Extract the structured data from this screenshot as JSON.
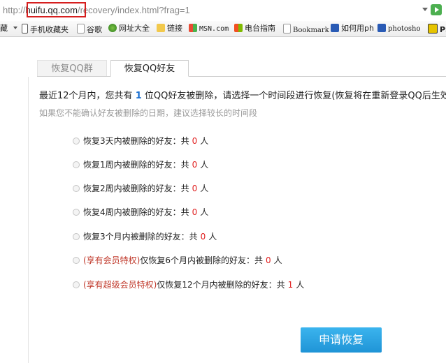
{
  "address_bar": {
    "url_prefix": "http://",
    "url_domain": "huifu.qq.com",
    "url_path": "/recovery/index.html?frag=1"
  },
  "bookmarks": [
    {
      "label": "藏",
      "icon": "star-icon"
    },
    {
      "label": "手机收藏夹",
      "icon": "phone-icon"
    },
    {
      "label": "谷歌",
      "icon": "page-icon"
    },
    {
      "label": "网址大全",
      "icon": "globe-icon"
    },
    {
      "label": "链接",
      "icon": "folder-icon"
    },
    {
      "label": "MSN.com",
      "icon": "msn-icon"
    },
    {
      "label": "电台指南",
      "icon": "windows-icon"
    },
    {
      "label": "Bookmark",
      "icon": "page-icon"
    },
    {
      "label": "如何用ph",
      "icon": "paw-icon"
    },
    {
      "label": "photosho",
      "icon": "paw-icon"
    },
    {
      "label": "PS",
      "icon": "ps-icon"
    }
  ],
  "tabs": [
    {
      "label": "恢复QQ群"
    },
    {
      "label": "恢复QQ好友"
    }
  ],
  "intro": {
    "before": "最近12个月内，您共有",
    "count": "1",
    "after": "位QQ好友被删除，请选择一个时间段进行恢复(恢复将在重新登录QQ后生效)："
  },
  "note": "如果您不能确认好友被删除的日期，建议选择较长的时间段",
  "options": [
    {
      "privilege": "",
      "text": "恢复3天内被删除的好友：共",
      "count": "0",
      "unit": "人"
    },
    {
      "privilege": "",
      "text": "恢复1周内被删除的好友：共",
      "count": "0",
      "unit": "人"
    },
    {
      "privilege": "",
      "text": "恢复2周内被删除的好友：共",
      "count": "0",
      "unit": "人"
    },
    {
      "privilege": "",
      "text": "恢复4周内被删除的好友：共",
      "count": "0",
      "unit": "人"
    },
    {
      "privilege": "",
      "text": "恢复3个月内被删除的好友：共",
      "count": "0",
      "unit": "人"
    },
    {
      "privilege": "(享有会员特权)",
      "text": "仅恢复6个月内被删除的好友：共",
      "count": "0",
      "unit": "人"
    },
    {
      "privilege": "(享有超级会员特权)",
      "text": "仅恢复12个月内被删除的好友：共",
      "count": "1",
      "unit": "人"
    }
  ],
  "apply_button": "申请恢复"
}
